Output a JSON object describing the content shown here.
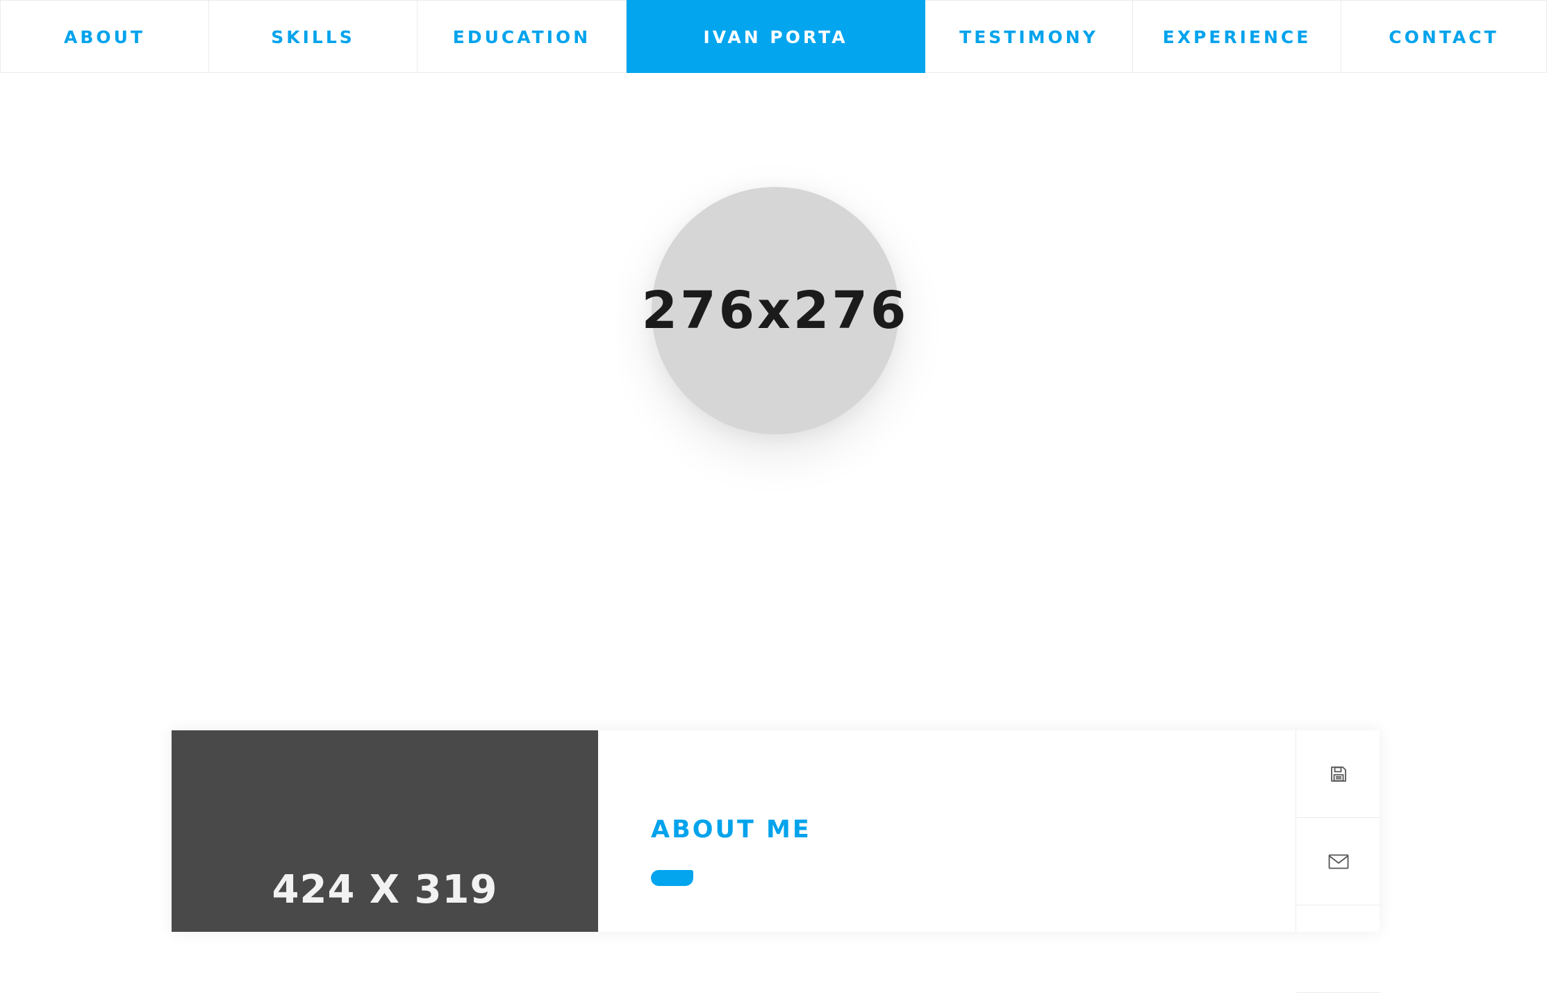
{
  "nav": {
    "items": [
      {
        "label": "ABOUT",
        "active": false
      },
      {
        "label": "SKILLS",
        "active": false
      },
      {
        "label": "EDUCATION",
        "active": false
      },
      {
        "label": "IVAN PORTA",
        "active": true
      },
      {
        "label": "TESTIMONY",
        "active": false
      },
      {
        "label": "EXPERIENCE",
        "active": false
      },
      {
        "label": "CONTACT",
        "active": false
      }
    ]
  },
  "profile": {
    "avatar_placeholder": "276x276"
  },
  "about": {
    "photo_placeholder": "424 X 319",
    "title": "ABOUT ME",
    "actions": [
      {
        "icon": "save-icon"
      },
      {
        "icon": "envelope-icon"
      }
    ]
  },
  "colors": {
    "accent": "#03a5ee",
    "nav_text": "#03a3ec",
    "avatar_bg": "#d6d6d6",
    "photo_bg": "#494949"
  }
}
